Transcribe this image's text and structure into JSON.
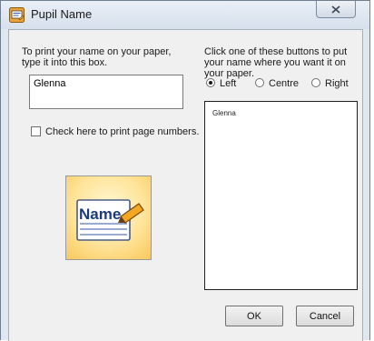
{
  "window": {
    "title": "Pupil Name",
    "icons": {
      "app": "app-icon",
      "close": "close-icon"
    }
  },
  "left": {
    "instruction": "To print your name on your paper, type it into this box.",
    "name_value": "Glenna",
    "checkbox_label": "Check here to print page numbers.",
    "checkbox_checked": false,
    "image_text": "Name"
  },
  "right": {
    "instruction": "Click one of these buttons to put your name where you want it on your paper.",
    "options": [
      "Left",
      "Centre",
      "Right"
    ],
    "selected": "Left",
    "preview_text": "Glenna"
  },
  "buttons": {
    "ok": "OK",
    "cancel": "Cancel"
  },
  "colors": {
    "title_bg": "#dfe7f1",
    "dialog_bg": "#f0f0f0",
    "icon_bg": "#ffe49a",
    "pencil": "#f5a623"
  }
}
